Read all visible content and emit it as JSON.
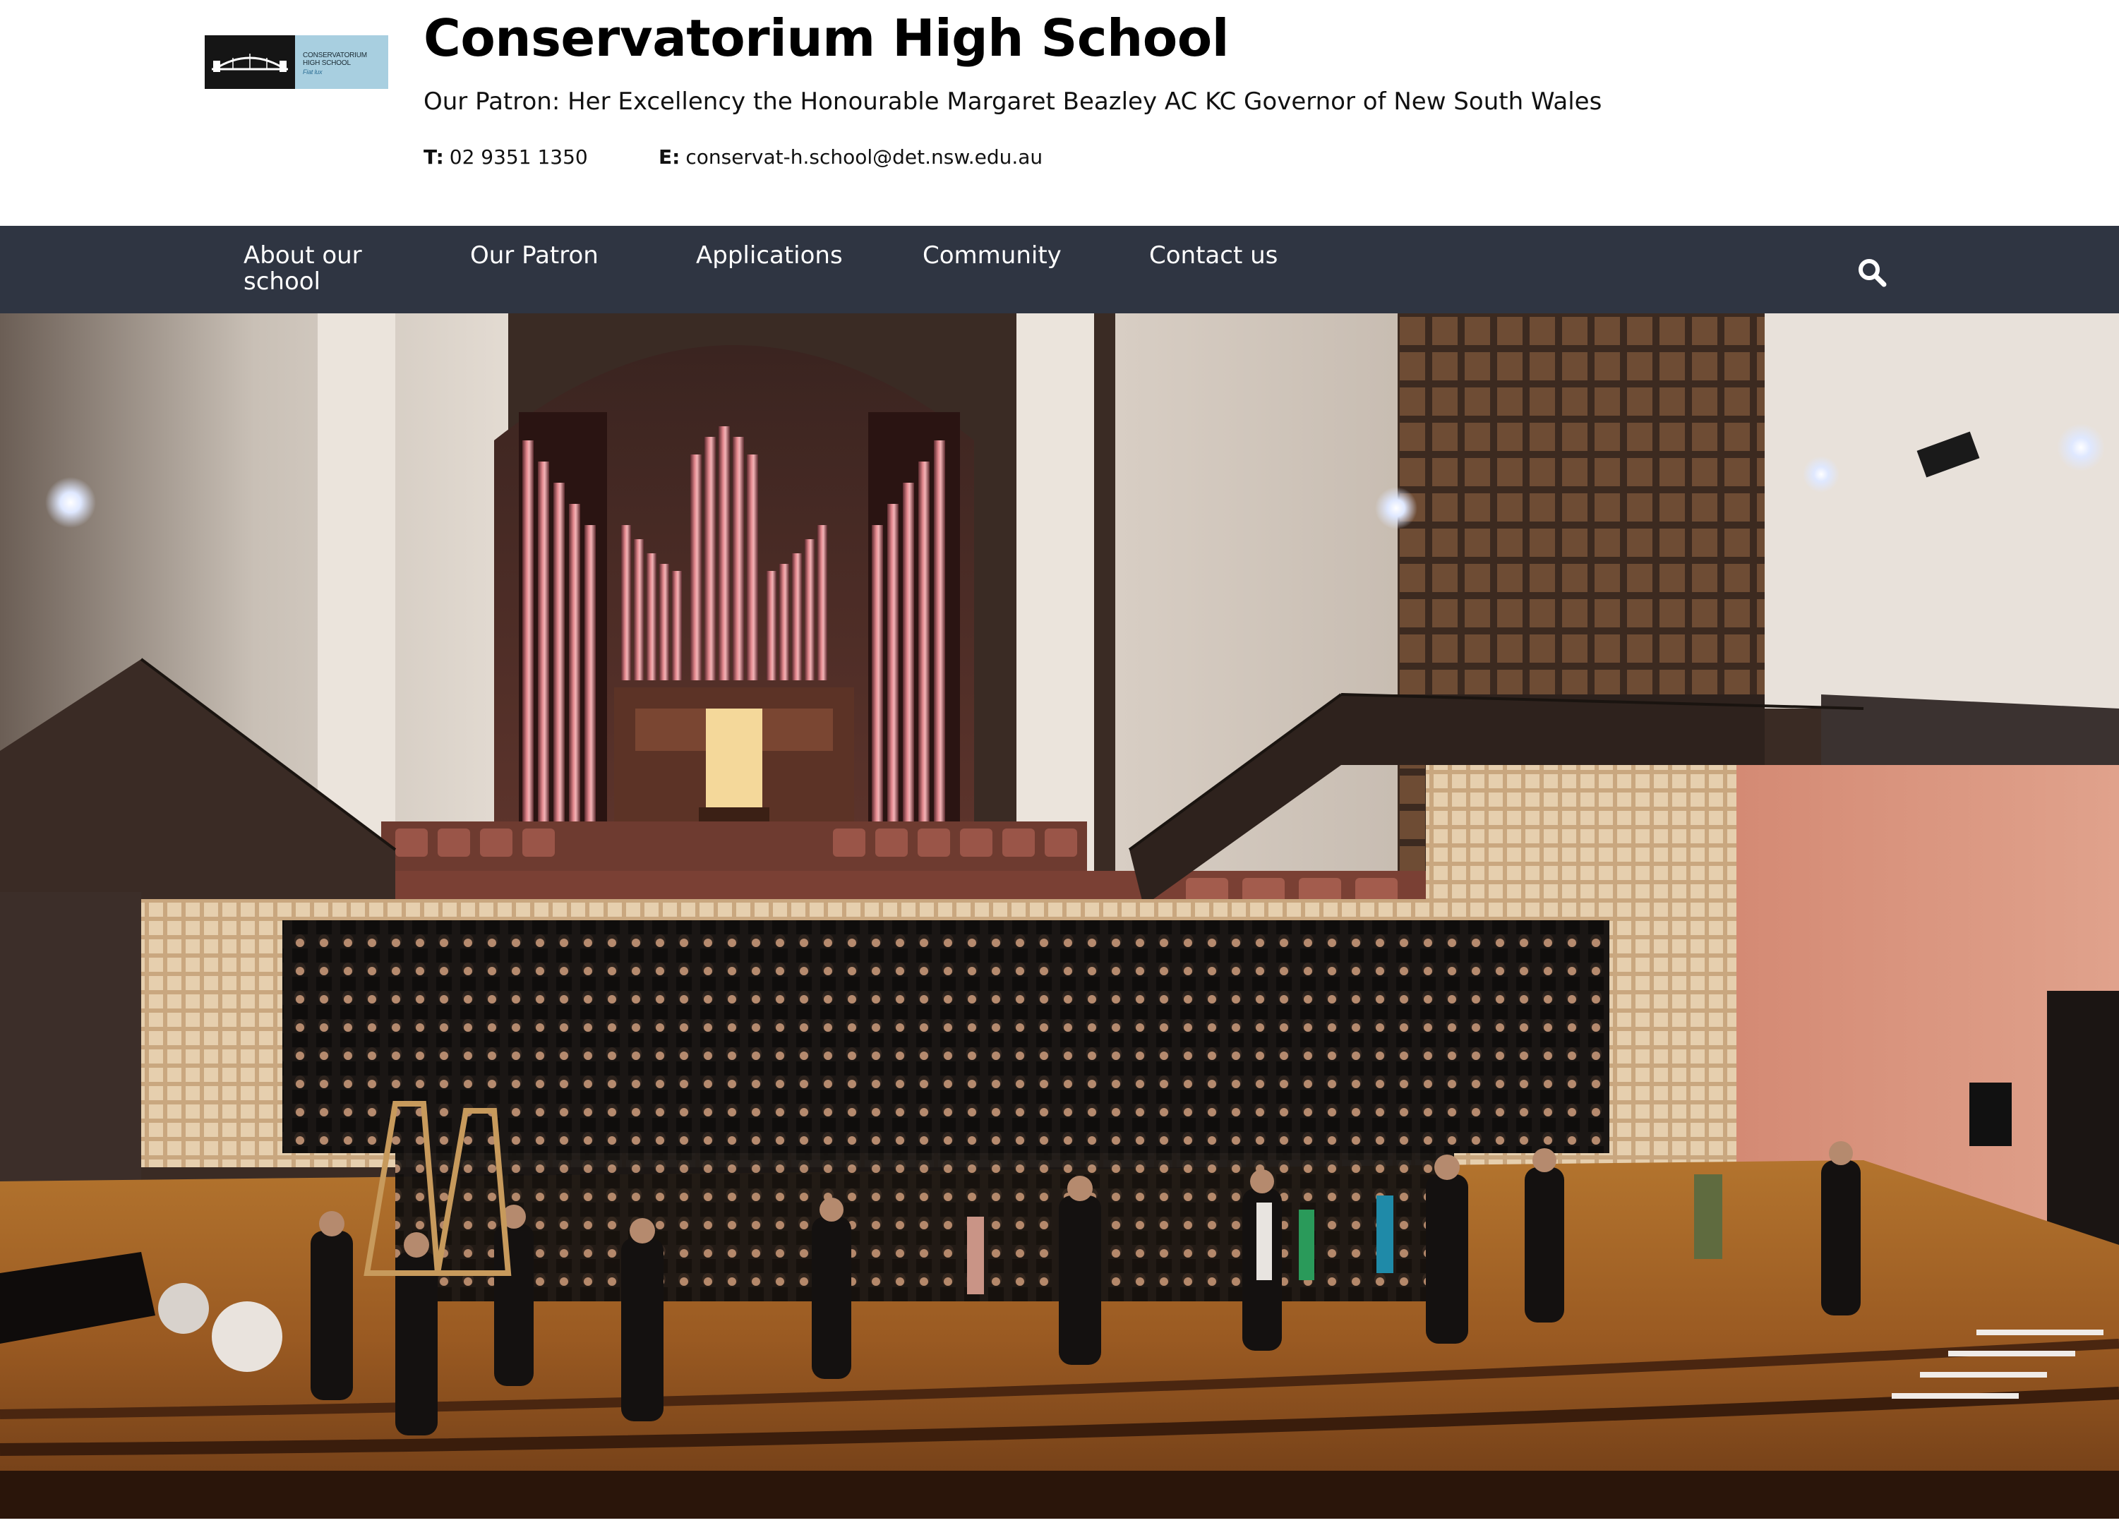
{
  "header": {
    "logo": {
      "name_lines": [
        "CONSERVATORIUM",
        "HIGH SCHOOL"
      ],
      "motto": "Fiat lux"
    },
    "title": "Conservatorium High School",
    "patron": "Our Patron: Her Excellency the Honourable Margaret Beazley AC KC Governor of New South Wales",
    "contact": {
      "phone_label": "T:",
      "phone": "02 9351 1350",
      "email_label": "E:",
      "email": "conservat-h.school@det.nsw.edu.au"
    }
  },
  "nav": {
    "items": [
      {
        "label": "About our school"
      },
      {
        "label": "Our Patron"
      },
      {
        "label": "Applications"
      },
      {
        "label": "Community"
      },
      {
        "label": "Contact us"
      }
    ],
    "search_icon": "search-icon"
  },
  "colors": {
    "nav_background": "#2f3542",
    "nav_text": "#ffffff",
    "logo_dark": "#151515",
    "logo_light": "#a8cfe0"
  }
}
